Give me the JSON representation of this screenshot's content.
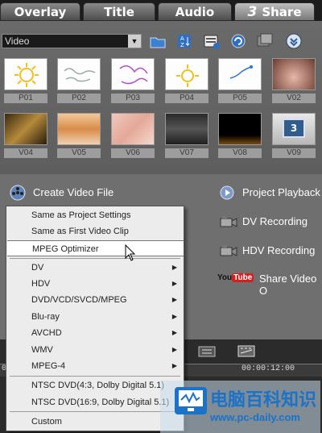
{
  "tabs": [
    {
      "label": "Overlay"
    },
    {
      "label": "Title"
    },
    {
      "label": "Audio"
    },
    {
      "number": "3",
      "label": "Share"
    }
  ],
  "library": {
    "dropdown_value": "Video",
    "toolbar_icons": [
      "open-folder-icon",
      "sort-icon",
      "list-options-icon",
      "capture-icon",
      "import-icon",
      "expand-icon"
    ],
    "thumbnails_row1": [
      "P01",
      "P02",
      "P03",
      "P04",
      "P05",
      "V02"
    ],
    "thumbnails_row2": [
      "V04",
      "V05",
      "V06",
      "V07",
      "V08",
      "V09"
    ],
    "thumb_badge": "3"
  },
  "options": {
    "create_video_file": "Create Video File",
    "project_playback": "Project Playback",
    "dv_recording": "DV Recording",
    "hdv_recording": "HDV Recording",
    "youtube_logo": "YouTube",
    "share_video": "Share Video O"
  },
  "timeline": {
    "timecode_left": "0",
    "timecode_right": "00:00:12:00"
  },
  "menu": {
    "items": [
      {
        "label": "Same as Project Settings",
        "submenu": false
      },
      {
        "label": "Same as First Video Clip",
        "submenu": false
      },
      {
        "label": "MPEG Optimizer",
        "submenu": false,
        "highlighted": true
      },
      {
        "label": "DV",
        "submenu": true
      },
      {
        "label": "HDV",
        "submenu": true
      },
      {
        "label": "DVD/VCD/SVCD/MPEG",
        "submenu": true
      },
      {
        "label": "Blu-ray",
        "submenu": true
      },
      {
        "label": "AVCHD",
        "submenu": true
      },
      {
        "label": "WMV",
        "submenu": true
      },
      {
        "label": "MPEG-4",
        "submenu": true
      },
      {
        "label": "NTSC DVD(4:3, Dolby Digital 5.1)",
        "submenu": false
      },
      {
        "label": "NTSC DVD(16:9, Dolby Digital 5.1)",
        "submenu": false
      },
      {
        "label": "Custom",
        "submenu": false
      }
    ],
    "submenu_arrow": "▶"
  },
  "watermark": {
    "title": "电脑百科知识",
    "url": "www.pc-daily.com"
  },
  "colors": {
    "menu_bg": "#ececec",
    "panel_bg": "#6f6f6f",
    "youtube_red": "#d21f1f",
    "watermark_blue": "#1a73c9"
  }
}
